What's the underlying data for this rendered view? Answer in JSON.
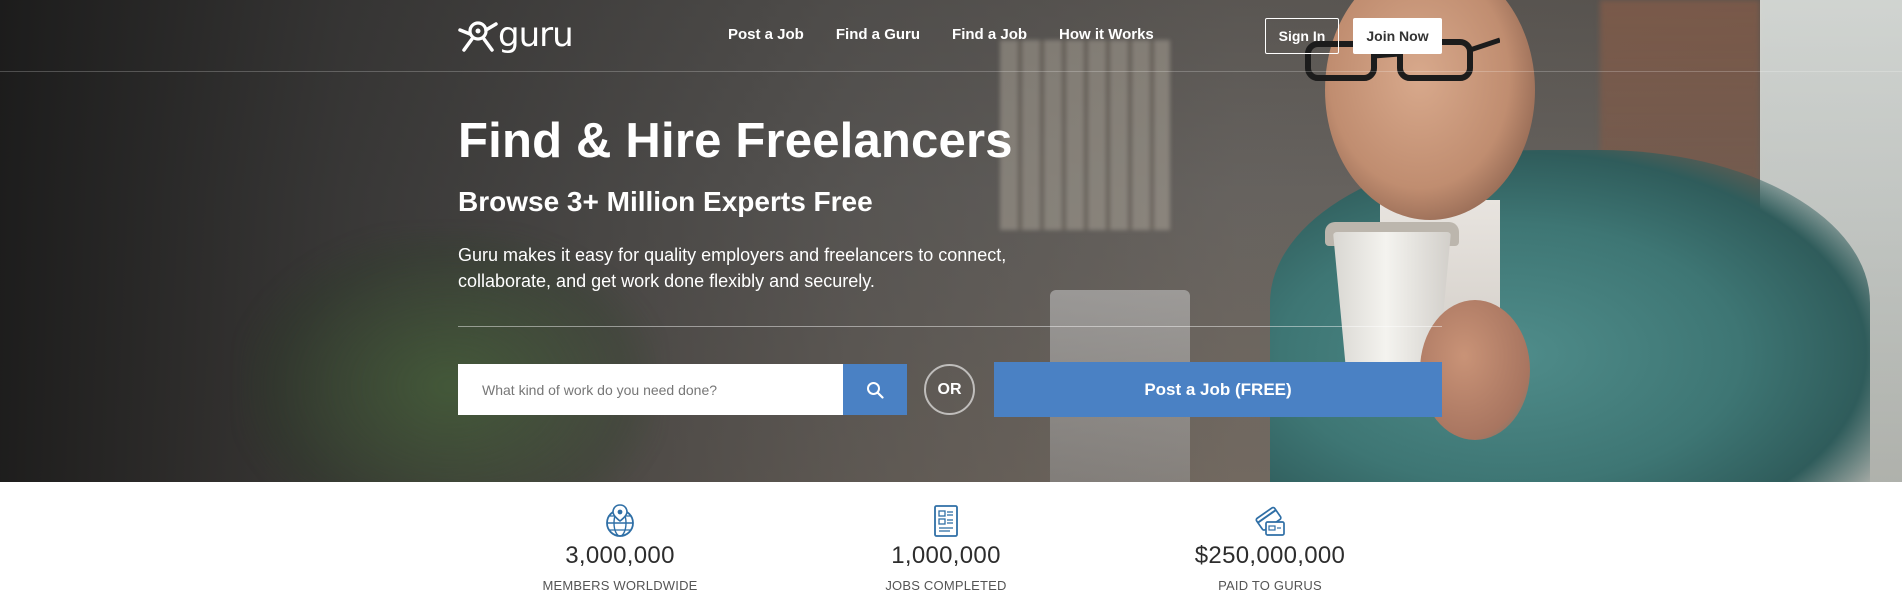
{
  "nav": {
    "logo_text": "guru",
    "links": [
      "Post a Job",
      "Find a Guru",
      "Find a Job",
      "How it Works"
    ],
    "sign_in": "Sign In",
    "join_now": "Join Now"
  },
  "hero": {
    "headline": "Find & Hire Freelancers",
    "subheadline": "Browse 3+ Million Experts Free",
    "description": "Guru makes it easy for quality employers and freelancers to connect, collaborate, and get work done flexibly and securely."
  },
  "search": {
    "placeholder": "What kind of work do you need done?",
    "icon": "search-icon",
    "or_label": "OR",
    "post_job_button": "Post a Job (FREE)"
  },
  "stats": [
    {
      "icon": "globe-pin-icon",
      "value": "3,000,000",
      "label": "MEMBERS WORLDWIDE"
    },
    {
      "icon": "document-icon",
      "value": "1,000,000",
      "label": "JOBS COMPLETED"
    },
    {
      "icon": "payment-card-icon",
      "value": "$250,000,000",
      "label": "PAID TO GURUS"
    }
  ],
  "colors": {
    "accent_blue": "#4a81c4",
    "icon_blue": "#2f6fa6",
    "text_dark": "#2d2d2d"
  }
}
